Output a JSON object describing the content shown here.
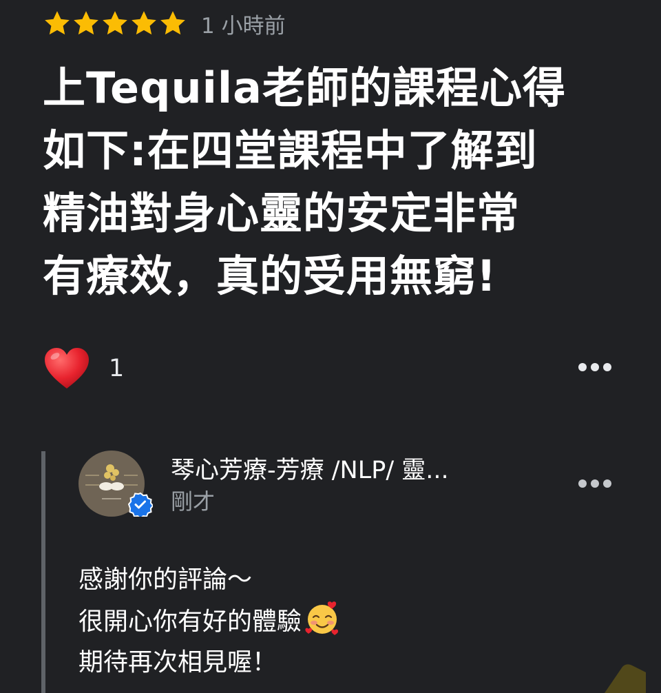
{
  "review": {
    "rating": 5,
    "rating_max": 5,
    "star_color": "#fbbc04",
    "time_ago": "1 小時前",
    "text": "上Tequila老師的課程心得\n如下:在四堂課程中了解到\n精油對身心靈的安定非常\n有療效，真的受用無窮!"
  },
  "reactions": {
    "icon": "red-heart-icon",
    "count": "1",
    "more_icon": "more-horizontal-icon"
  },
  "owner_reply": {
    "avatar_icon": "business-logo-avatar",
    "verified_icon": "verified-check-icon",
    "verified_color": "#1a73e8",
    "name": "琴心芳療-芳療 /NLP/ 靈...",
    "time": "剛才",
    "lines": [
      "感謝你的評論～",
      "很開心你有好的體驗",
      "期待再次相見喔！"
    ],
    "emoji": "smiling-face-with-hearts-icon",
    "more_icon": "more-horizontal-icon"
  },
  "colors": {
    "background": "#202124",
    "primary_text": "#ffffff",
    "secondary_text": "#9aa0a6",
    "reply_bar": "#5f6368"
  }
}
